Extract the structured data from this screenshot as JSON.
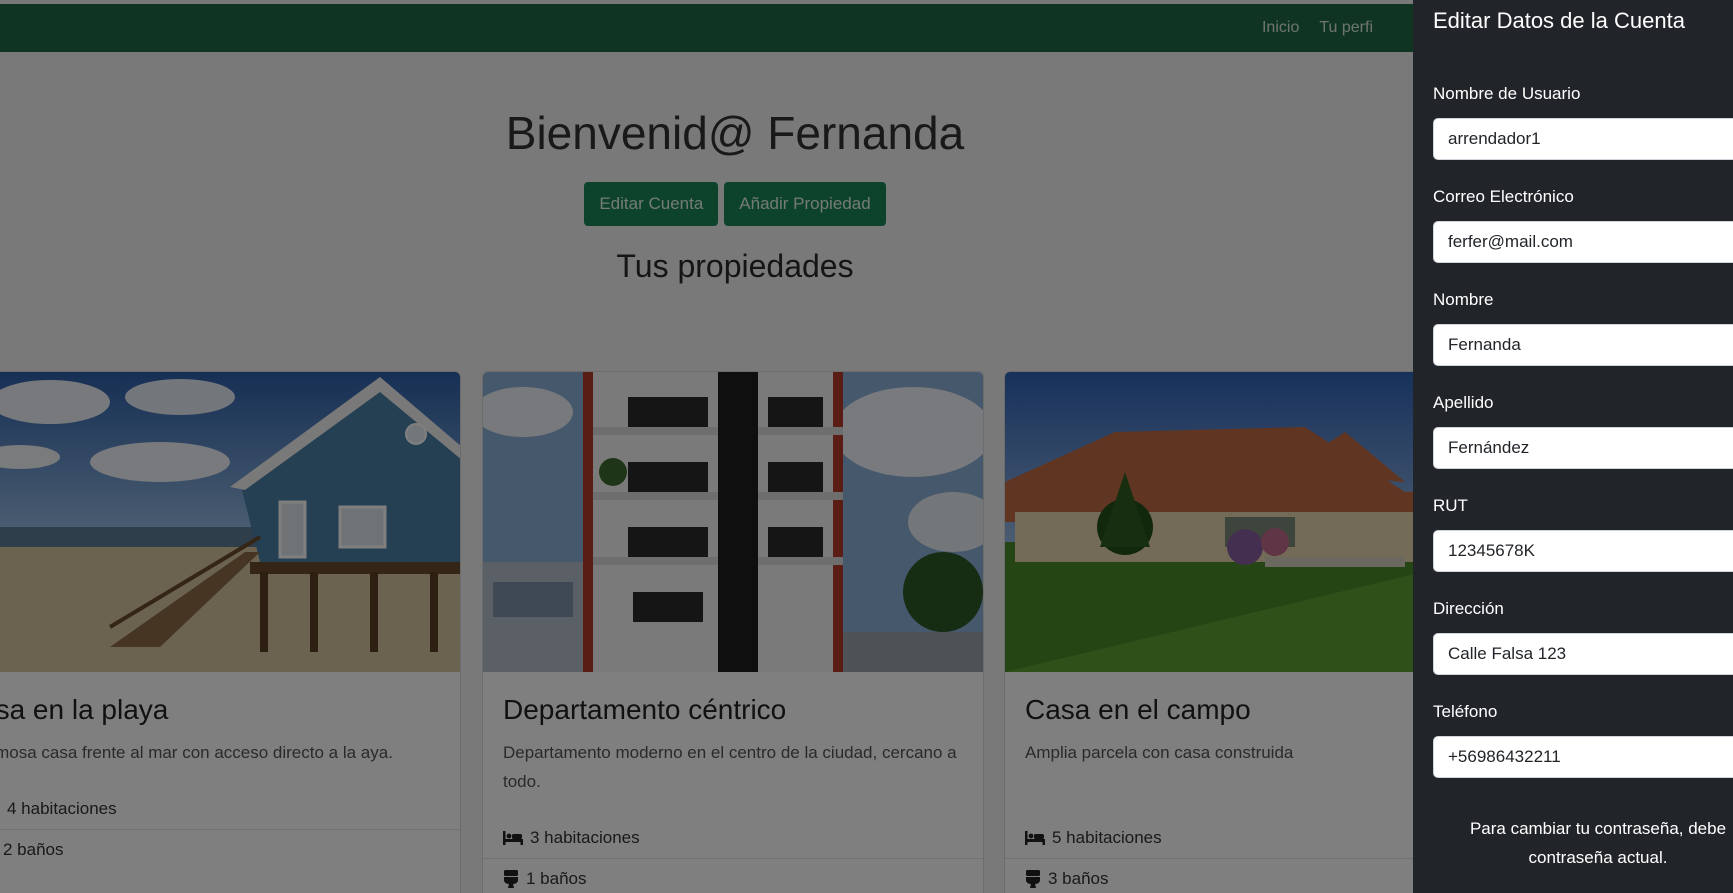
{
  "navbar": {
    "links": [
      "Inicio",
      "Tu perfi"
    ]
  },
  "hero": {
    "title": "Bienvenid@ Fernanda",
    "edit_button": "Editar Cuenta",
    "add_button": "Añadir Propiedad",
    "subtitle": "Tus propiedades"
  },
  "properties": [
    {
      "title": "asa en la playa",
      "description": "ermosa casa frente al mar con acceso directo a la aya.",
      "rooms": "4 habitaciones",
      "baths": "2 baños"
    },
    {
      "title": "Departamento céntrico",
      "description": "Departamento moderno en el centro de la ciudad, cercano a todo.",
      "rooms": "3 habitaciones",
      "baths": "1 baños"
    },
    {
      "title": "Casa en el campo",
      "description": "Amplia parcela con casa construida",
      "rooms": "5 habitaciones",
      "baths": "3 baños"
    }
  ],
  "offcanvas": {
    "title": "Editar Datos de la Cuenta",
    "fields": [
      {
        "label": "Nombre de Usuario",
        "value": "arrendador1"
      },
      {
        "label": "Correo Electrónico",
        "value": "ferfer@mail.com"
      },
      {
        "label": "Nombre",
        "value": "Fernanda"
      },
      {
        "label": "Apellido",
        "value": "Fernández"
      },
      {
        "label": "RUT",
        "value": "12345678K"
      },
      {
        "label": "Dirección",
        "value": "Calle Falsa 123"
      },
      {
        "label": "Teléfono",
        "value": "+56986432211"
      }
    ],
    "help_text": "Para cambiar tu contraseña, debe contraseña actual."
  },
  "colors": {
    "navbar": "#1e6b45",
    "button": "#198754",
    "offcanvas": "#212529"
  }
}
